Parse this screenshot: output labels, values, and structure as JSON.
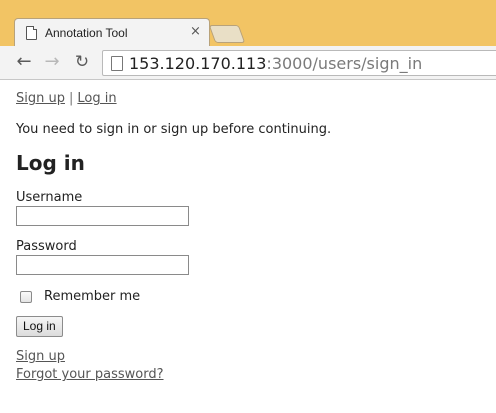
{
  "browser": {
    "tab": {
      "title": "Annotation Tool",
      "close_glyph": "×",
      "icon": "document-icon"
    },
    "nav": {
      "back_glyph": "←",
      "forward_glyph": "→",
      "reload_glyph": "↻"
    },
    "address": {
      "host": "153.120.170.113",
      "path": ":3000/users/sign_in"
    }
  },
  "page": {
    "top_nav": {
      "sign_up": "Sign up",
      "separator": "|",
      "log_in": "Log in"
    },
    "notice": "You need to sign in or sign up before continuing.",
    "heading": "Log in",
    "form": {
      "username_label": "Username",
      "username_value": "",
      "password_label": "Password",
      "password_value": "",
      "remember_label": "Remember me",
      "remember_checked": false,
      "submit_label": "Log in"
    },
    "links": {
      "sign_up": "Sign up",
      "forgot_password": "Forgot your password?"
    }
  },
  "colors": {
    "tabstrip": "#f2c464",
    "link": "#555555"
  }
}
